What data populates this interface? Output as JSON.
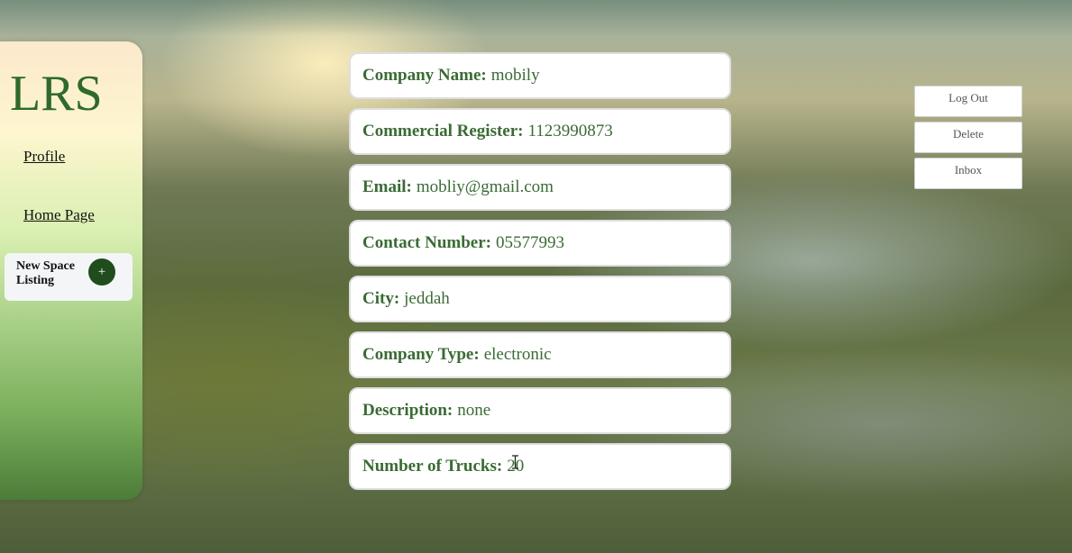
{
  "sidebar": {
    "logo": "LRS",
    "links": {
      "profile": "Profile",
      "home": "Home Page"
    },
    "new_listing": {
      "label": "New Space Listing",
      "button": "+"
    }
  },
  "profile": {
    "fields": [
      {
        "label": "Company Name:",
        "value": "mobily"
      },
      {
        "label": "Commercial Register:",
        "value": "1123990873"
      },
      {
        "label": "Email:",
        "value": "mobliy@gmail.com"
      },
      {
        "label": "Contact Number:",
        "value": "05577993"
      },
      {
        "label": "City:",
        "value": "jeddah"
      },
      {
        "label": "Company Type:",
        "value": "electronic"
      },
      {
        "label": "Description:",
        "value": "none"
      },
      {
        "label": "Number of Trucks:",
        "value": "20"
      }
    ]
  },
  "actions": {
    "logout": "Log Out",
    "delete": "Delete",
    "inbox": "Inbox"
  },
  "colors": {
    "accent_green": "#3a6b34",
    "logo_green": "#2f6a2a",
    "plus_button": "#1f4d1c"
  },
  "icons": {
    "cursor": "text-cursor-icon"
  }
}
